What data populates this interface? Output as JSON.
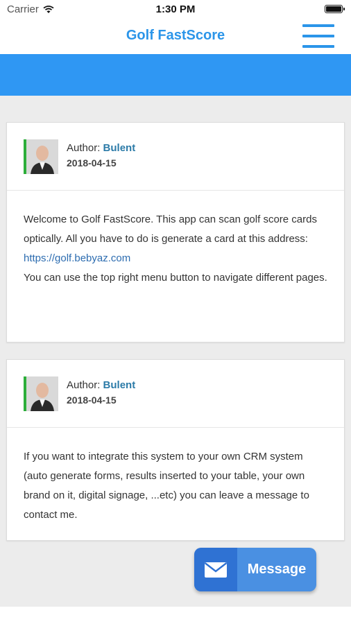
{
  "status_bar": {
    "carrier": "Carrier",
    "time": "1:30 PM"
  },
  "nav": {
    "title": "Golf FastScore",
    "menu_icon": "hamburger-menu-icon"
  },
  "posts": [
    {
      "author_label": "Author:",
      "author_name": "Bulent",
      "date": "2018-04-15",
      "body": "Welcome to Golf FastScore. This app can scan golf score cards optically. All you have to do is generate a card at this address:",
      "link": "https://golf.bebyaz.com",
      "body_after": "You can use the top right menu button to navigate different pages."
    },
    {
      "author_label": "Author:",
      "author_name": "Bulent",
      "date": "2018-04-15",
      "body": "If you want to integrate this system to your own CRM system (auto generate forms, results inserted to your table, your own brand on it, digital signage, ...etc) you can leave a message to contact me."
    }
  ],
  "message_button": {
    "label": "Message",
    "icon": "envelope-icon"
  },
  "colors": {
    "accent": "#2b95e9",
    "band": "#2f97f3",
    "author_name": "#2c7ba8",
    "avatar_border": "#2cae3a",
    "message_button": "#4a90e2"
  }
}
